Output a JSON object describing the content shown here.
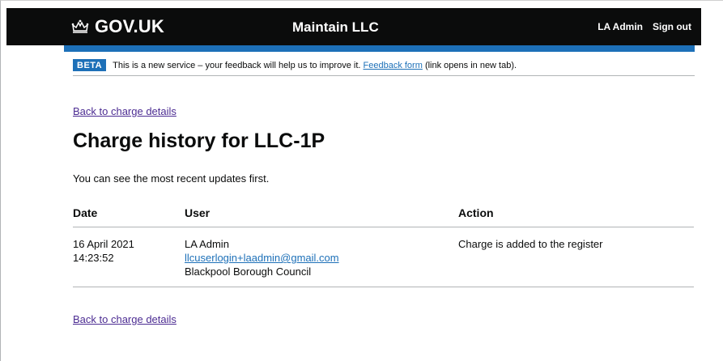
{
  "header": {
    "logo_text": "GOV.UK",
    "logo_icon": "crown-icon",
    "service_name": "Maintain LLC",
    "nav": {
      "user_label": "LA Admin",
      "sign_out_label": "Sign out"
    },
    "background": "#0b0c0c",
    "accent_bar": "#1d70b8"
  },
  "phase_banner": {
    "tag": "BETA",
    "text_before": "This is a new service – your feedback will help us to improve it.",
    "link_text": "Feedback form",
    "text_after": "(link opens in new tab)."
  },
  "back_link_top": "Back to charge details",
  "page": {
    "title": "Charge history for LLC-1P",
    "intro": "You can see the most recent updates first."
  },
  "table": {
    "headers": {
      "date": "Date",
      "user": "User",
      "action": "Action"
    },
    "rows": [
      {
        "date": "16 April 2021",
        "time": "14:23:52",
        "user_name": "LA Admin",
        "user_email": "llcuserlogin+laadmin@gmail.com",
        "user_org": "Blackpool Borough Council",
        "action": "Charge is added to the register"
      }
    ]
  },
  "back_link_bottom": "Back to charge details",
  "colors": {
    "link": "#1d70b8",
    "visited_link": "#4c2c92",
    "text": "#0b0c0c",
    "border": "#b1b4b6"
  }
}
